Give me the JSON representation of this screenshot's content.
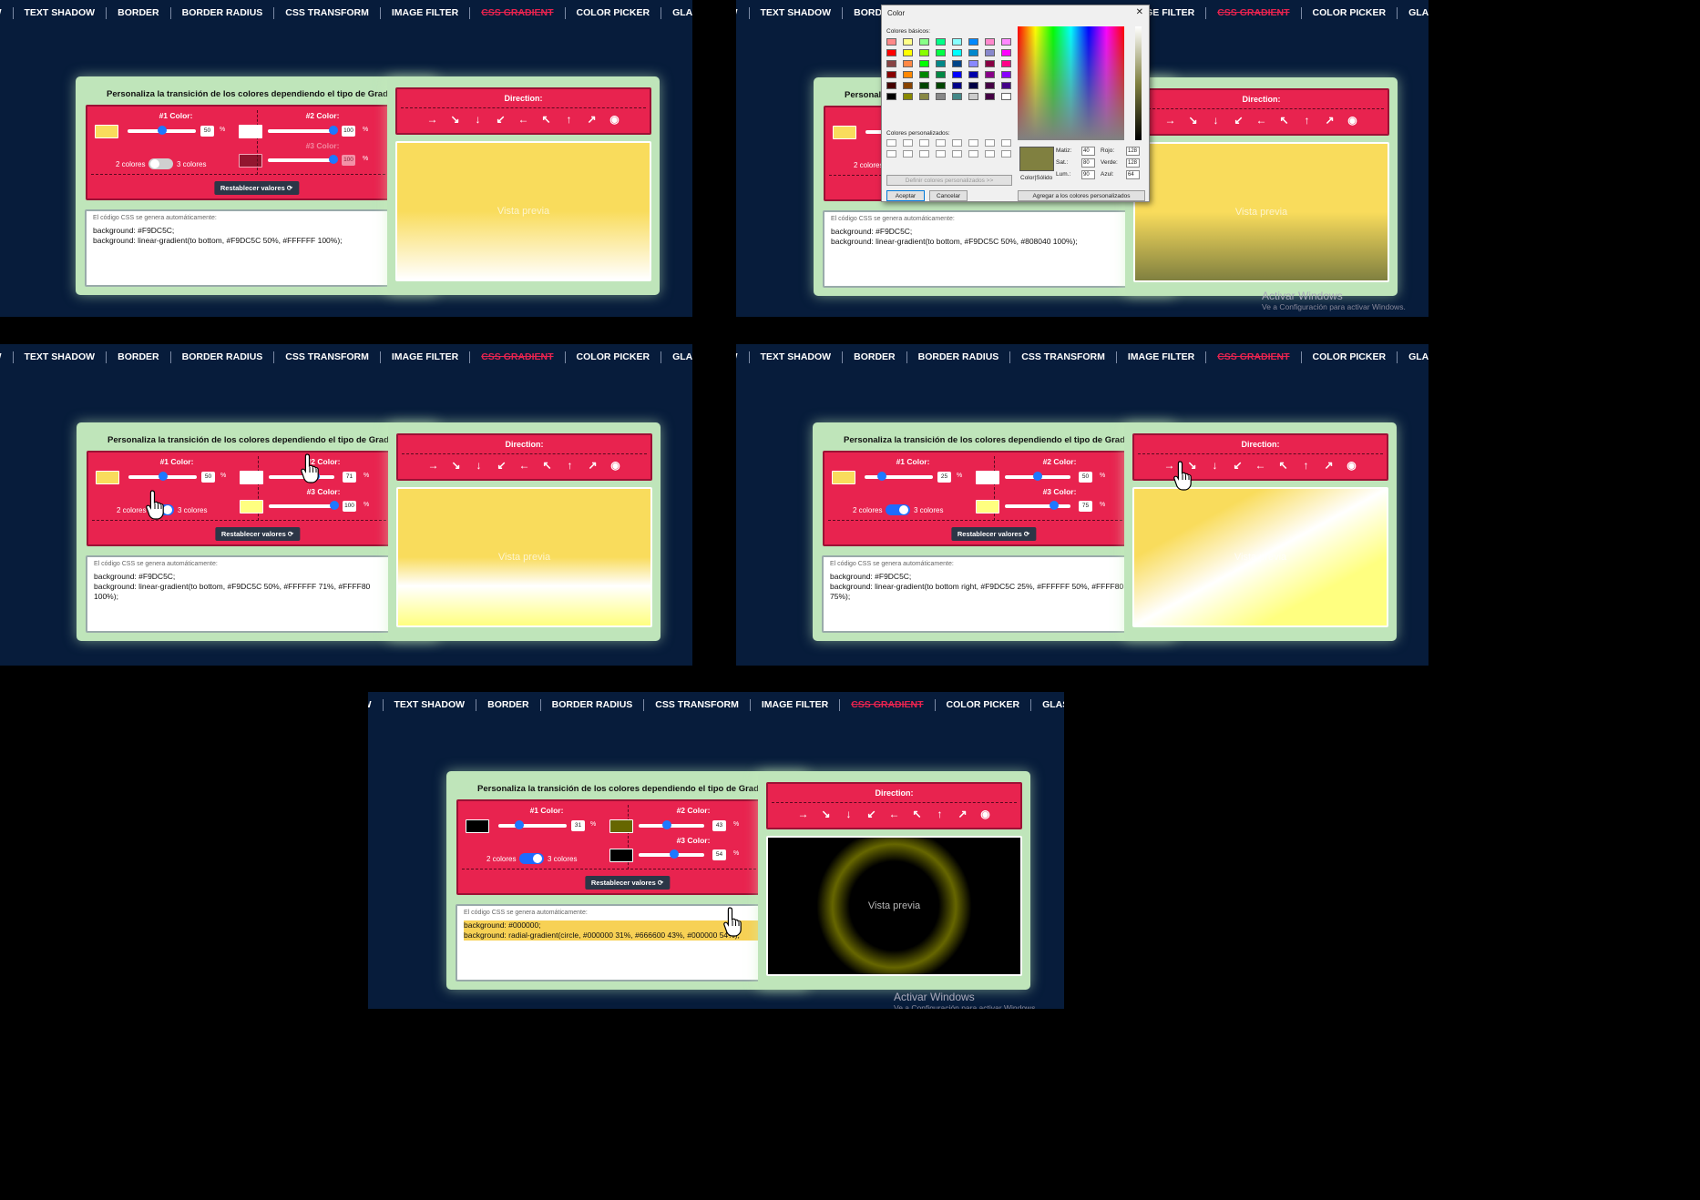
{
  "nav": [
    "BOX SHADOW",
    "TEXT SHADOW",
    "BORDER",
    "BORDER RADIUS",
    "CSS TRANSFORM",
    "IMAGE FILTER",
    "CSS GRADIENT",
    "COLOR PICKER",
    "GLASSMORPHISM"
  ],
  "active_nav": "CSS GRADIENT",
  "panel_title": "Personaliza la transición de los colores dependiendo el tipo de Gradient:",
  "color1_label": "#1 Color:",
  "color2_label": "#2 Color:",
  "color3_label": "#3 Color:",
  "pct": "%",
  "two_colors": "2 colores",
  "three_colors": "3 colores",
  "reset": "Restablecer valores ⟳",
  "code_note": "El código CSS se genera automáticamente:",
  "direction": "Direction:",
  "arrows": [
    "→",
    "↘",
    "↓",
    "↙",
    "←",
    "↖",
    "↑",
    "↗",
    "◉"
  ],
  "preview": "Vista previa",
  "activate_title": "Activar Windows",
  "activate_sub": "Ve a Configuración para activar Windows.",
  "states": [
    {
      "c1": "#F9DC5C",
      "s1": "50",
      "c2": "#FFFFFF",
      "s2": "100",
      "c3": "#5a0f1a",
      "s3": "100",
      "three": false,
      "l1": "background: #F9DC5C;",
      "l2": "background: linear-gradient(to bottom, #F9DC5C 50%, #FFFFFF 100%);"
    },
    {
      "c1": "#F9DC5C",
      "s1": "50",
      "c2": "#808040",
      "s2": "100",
      "c3": "#5a0f1a",
      "s3": "100",
      "three": false,
      "l1": "background: #F9DC5C;",
      "l2": "background: linear-gradient(to bottom, #F9DC5C 50%, #808040 100%);"
    },
    {
      "c1": "#F9DC5C",
      "s1": "50",
      "c2": "#FFFFFF",
      "s2": "71",
      "c3": "#FFFF80",
      "s3": "100",
      "three": true,
      "l1": "background: #F9DC5C;",
      "l2": "background: linear-gradient(to bottom, #F9DC5C 50%, #FFFFFF 71%, #FFFF80 100%);"
    },
    {
      "c1": "#F9DC5C",
      "s1": "25",
      "c2": "#FFFFFF",
      "s2": "50",
      "c3": "#FFFF80",
      "s3": "75",
      "three": true,
      "l1": "background: #F9DC5C;",
      "l2": "background: linear-gradient(to bottom right, #F9DC5C 25%, #FFFFFF 50%, #FFFF80 75%);"
    },
    {
      "c1": "#000000",
      "s1": "31",
      "c2": "#666600",
      "s2": "43",
      "c3": "#000000",
      "s3": "54",
      "three": true,
      "l1": "background: #000000;",
      "l2": "background: radial-gradient(circle, #000000 31%, #666600 43%, #000000 54%);"
    }
  ],
  "dialog": {
    "title": "Color",
    "basic": "Colores básicos:",
    "custom": "Colores personalizados:",
    "define": "Definir colores personalizados >>",
    "ok": "Aceptar",
    "cancel": "Cancelar",
    "add": "Agregar a los colores personalizados",
    "solid": "Color|Sólido",
    "hue_l": "Matiz:",
    "hue": "40",
    "sat_l": "Sat.:",
    "sat": "80",
    "lum_l": "Lum.:",
    "lum": "90",
    "red_l": "Rojo:",
    "red": "128",
    "green_l": "Verde:",
    "green": "128",
    "blue_l": "Azul:",
    "blue": "64",
    "basic_colors": [
      "#f88",
      "#ff8",
      "#8f8",
      "#0f8",
      "#8ff",
      "#08f",
      "#f8c",
      "#f8f",
      "#f00",
      "#ff0",
      "#8f0",
      "#0f4",
      "#0ff",
      "#08c",
      "#88c",
      "#f0f",
      "#844",
      "#f84",
      "#0f0",
      "#088",
      "#048",
      "#88f",
      "#804",
      "#f08",
      "#800",
      "#f80",
      "#080",
      "#084",
      "#00f",
      "#00a",
      "#808",
      "#80f",
      "#400",
      "#840",
      "#040",
      "#040",
      "#008",
      "#004",
      "#404",
      "#408",
      "#000",
      "#880",
      "#884",
      "#888",
      "#488",
      "#ccc",
      "#404",
      "#fff"
    ]
  },
  "colors": {
    "accent": "#e8234f",
    "bg": "#071c3b",
    "panel": "#bfe5ba",
    "knob": "#1e78ff"
  }
}
